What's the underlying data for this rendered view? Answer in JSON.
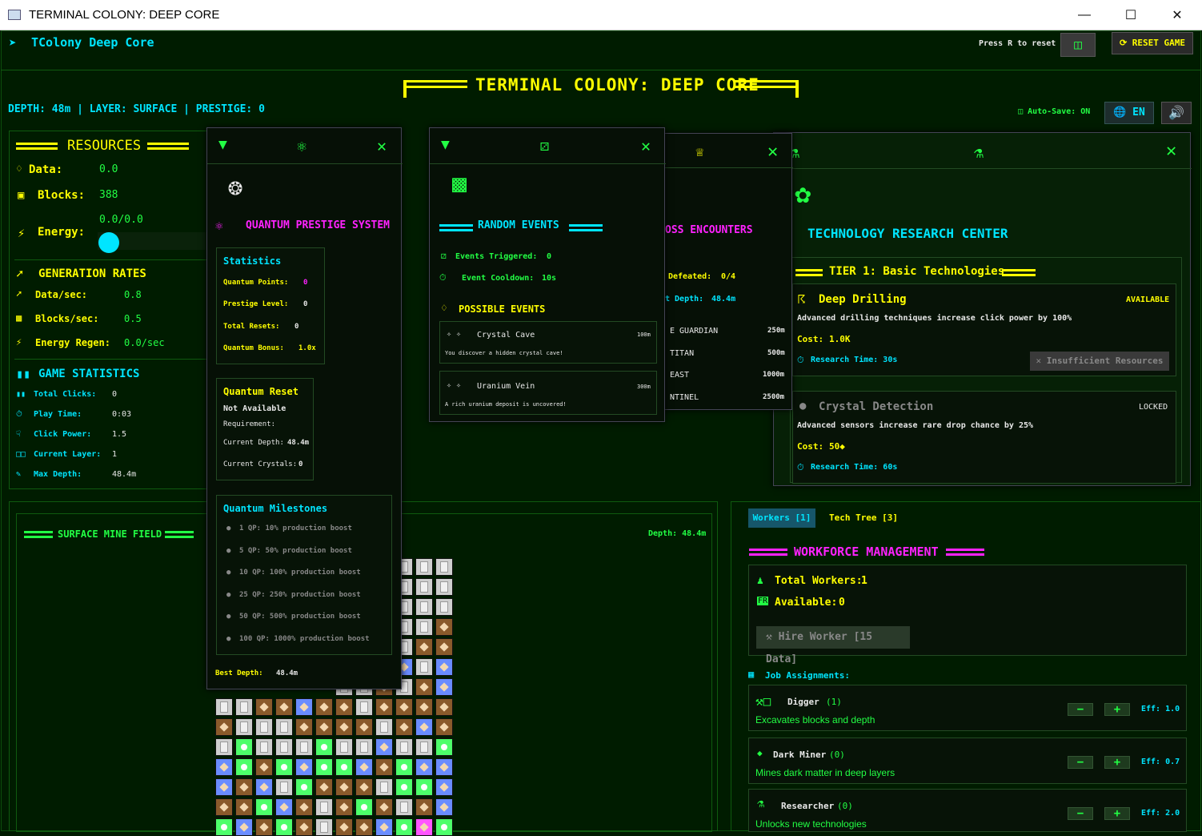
{
  "window": {
    "title": "TERMINAL COLONY: DEEP CORE"
  },
  "topbar": {
    "brand": "TColony Deep Core",
    "reset_hint": "Press R to reset",
    "reset_label": "RESET GAME"
  },
  "header": {
    "title": "TERMINAL COLONY: DEEP CORE",
    "status": "DEPTH: 48m | LAYER: SURFACE | PRESTIGE: 0",
    "autosave": "Auto-Save: ON",
    "lang": "EN"
  },
  "resources": {
    "title": "RESOURCES",
    "data_label": "Data:",
    "data_value": "0.0",
    "blocks_label": "Blocks:",
    "blocks_value": "388",
    "energy_label": "Energy:",
    "energy_value": "0.0/0.0"
  },
  "rates": {
    "title": "GENERATION RATES",
    "items": [
      {
        "label": "Data/sec:",
        "value": "0.8"
      },
      {
        "label": "Blocks/sec:",
        "value": "0.5"
      },
      {
        "label": "Energy Regen:",
        "value": "0.0/sec"
      }
    ]
  },
  "stats": {
    "title": "GAME STATISTICS",
    "items": [
      {
        "label": "Total Clicks:",
        "value": "0"
      },
      {
        "label": "Play Time:",
        "value": "0:03"
      },
      {
        "label": "Click Power:",
        "value": "1.5"
      },
      {
        "label": "Current Layer:",
        "value": "1"
      },
      {
        "label": "Max Depth:",
        "value": "48.4m"
      }
    ]
  },
  "quantum": {
    "title": "QUANTUM PRESTIGE SYSTEM",
    "stats_title": "Statistics",
    "stats": [
      {
        "label": "Quantum Points:",
        "value": "0"
      },
      {
        "label": "Prestige Level:",
        "value": "0"
      },
      {
        "label": "Total Resets:",
        "value": "0"
      },
      {
        "label": "Quantum Bonus:",
        "value": "1.0x"
      }
    ],
    "reset_title": "Quantum Reset",
    "reset_status": "Not Available",
    "requirement": "Requirement:",
    "current_depth": "Current Depth:",
    "current_depth_v": "48.4m",
    "current_crystals": "Current Crystals:",
    "current_crystals_v": "0",
    "milestones_title": "Quantum Milestones",
    "milestones": [
      "1 QP:  10% production boost",
      "5 QP:  50% production boost",
      "10 QP:  100% production boost",
      "25 QP:  250% production boost",
      "50 QP:  500% production boost",
      "100 QP:  1000% production boost"
    ],
    "best_depth": "Best Depth:",
    "best_depth_v": "48.4m"
  },
  "events": {
    "title": "RANDOM EVENTS",
    "triggered": "Events Triggered:",
    "triggered_v": "0",
    "cooldown": "Event Cooldown:",
    "cooldown_v": "10s",
    "possible": "POSSIBLE EVENTS",
    "list": [
      {
        "name": "Crystal Cave",
        "depth": "100m",
        "desc": "You discover a hidden crystal cave!"
      },
      {
        "name": "Uranium Vein",
        "depth": "300m",
        "desc": "A rich uranium deposit is uncovered!"
      }
    ]
  },
  "boss": {
    "title": "OSS ENCOUNTERS",
    "defeated": "Defeated:",
    "defeated_v": "0/4",
    "depth": "t Depth:",
    "depth_v": "48.4m",
    "list": [
      {
        "name": "E GUARDIAN",
        "depth": "250m"
      },
      {
        "name": "TITAN",
        "depth": "500m"
      },
      {
        "name": "EAST",
        "depth": "1000m"
      },
      {
        "name": "NTINEL",
        "depth": "2500m"
      }
    ]
  },
  "tech": {
    "title": "TECHNOLOGY RESEARCH CENTER",
    "tier": "TIER 1: Basic Technologies",
    "items": [
      {
        "name": "Deep Drilling",
        "status": "AVAILABLE",
        "desc": "Advanced drilling techniques increase click power by 100%",
        "cost_label": "Cost:",
        "cost": "1.0K",
        "time": "Research Time: 30s",
        "btn": "Insufficient Resources"
      },
      {
        "name": "Crystal Detection",
        "status": "LOCKED",
        "desc": "Advanced sensors increase rare drop chance by 25%",
        "cost_label": "Cost:",
        "cost": "50◆",
        "time": "Research Time: 60s"
      }
    ]
  },
  "mine": {
    "title": "SURFACE MINE FIELD",
    "depth": "Depth: 48.4m"
  },
  "workers": {
    "tabs": [
      "Workers [1]",
      "Tech Tree [3]"
    ],
    "title": "WORKFORCE MANAGEMENT",
    "total_label": "Total Workers:",
    "total": "1",
    "avail_label": "Available:",
    "avail": "0",
    "hire": "Hire Worker [15 Data]",
    "jobs_title": "Job Assignments:",
    "jobs": [
      {
        "name": "Digger",
        "count": "(1)",
        "desc": "Excavates blocks and depth",
        "eff": "Eff: 1.0"
      },
      {
        "name": "Dark Miner",
        "count": "(0)",
        "desc": "Mines dark matter in deep layers",
        "eff": "Eff: 0.7"
      },
      {
        "name": "Researcher",
        "count": "(0)",
        "desc": "Unlocks new technologies",
        "eff": "Eff: 2.0"
      }
    ]
  },
  "colors": {
    "yellow": "#ffff00",
    "cyan": "#00e5ff",
    "green": "#22ff44",
    "magenta": "#ff22ff"
  },
  "mine_grid": [
    "------SSSSSS",
    "------SDSSSS",
    "------SSSSSS",
    "------SSSSSD",
    "------DSDSDD",
    "------DBDBSB",
    "------SSDSDB",
    "SSDDBDDSDDDD",
    "DSSSDDDDSDBD",
    "SGSSSGSSBSSG",
    "BGDGBGGBDGBB",
    "BDBSGDDDSGGB",
    "DDGBDSDGDSDB",
    "GBDGDSDDBGPG"
  ]
}
